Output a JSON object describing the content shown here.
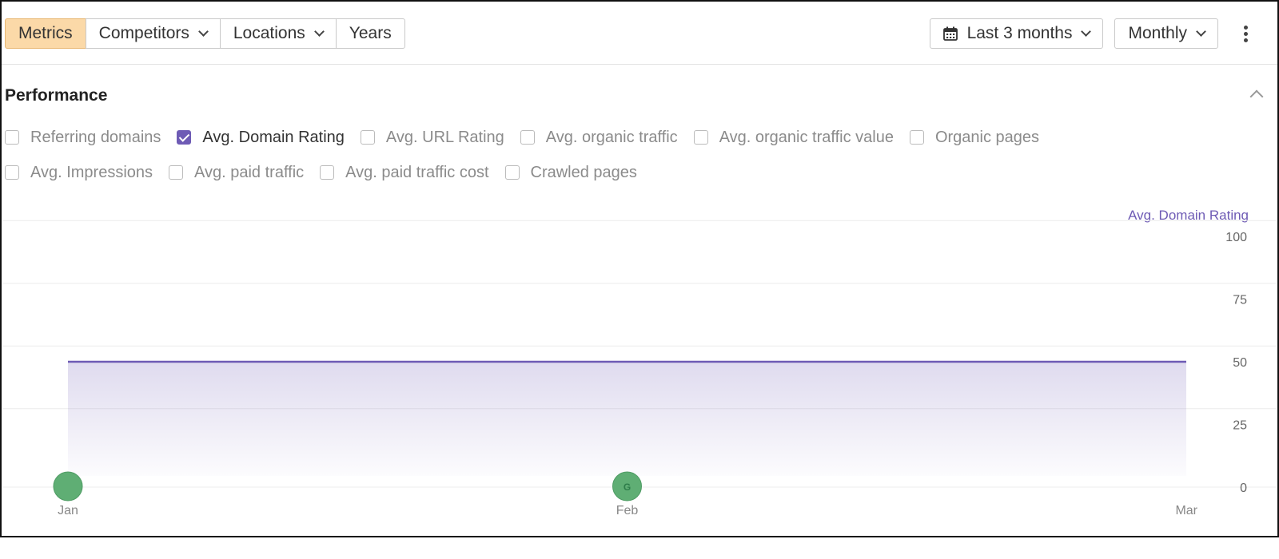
{
  "toolbar": {
    "tabs": [
      {
        "label": "Metrics",
        "active": true,
        "dropdown": false
      },
      {
        "label": "Competitors",
        "active": false,
        "dropdown": true
      },
      {
        "label": "Locations",
        "active": false,
        "dropdown": true
      },
      {
        "label": "Years",
        "active": false,
        "dropdown": false
      }
    ],
    "date_range": "Last 3 months",
    "granularity": "Monthly",
    "more_icon": "kebab-icon"
  },
  "performance": {
    "title": "Performance",
    "checkboxes_row1": [
      {
        "label": "Referring domains",
        "checked": false
      },
      {
        "label": "Avg. Domain Rating",
        "checked": true
      },
      {
        "label": "Avg. URL Rating",
        "checked": false
      },
      {
        "label": "Avg. organic traffic",
        "checked": false
      },
      {
        "label": "Avg. organic traffic value",
        "checked": false
      },
      {
        "label": "Organic pages",
        "checked": false
      }
    ],
    "checkboxes_row2": [
      {
        "label": "Avg. Impressions",
        "checked": false
      },
      {
        "label": "Avg. paid traffic",
        "checked": false
      },
      {
        "label": "Avg. paid traffic cost",
        "checked": false
      },
      {
        "label": "Crawled pages",
        "checked": false
      }
    ]
  },
  "colors": {
    "accent": "#6e5bb5",
    "active_tab": "#fbd9a8",
    "annotation": "#5fae74"
  },
  "chart_data": {
    "type": "area",
    "series": [
      {
        "name": "Avg. Domain Rating",
        "x": [
          "Jan",
          "Mar"
        ],
        "values": [
          50,
          50
        ]
      }
    ],
    "x_ticks": [
      "Jan",
      "Feb",
      "Mar"
    ],
    "y_ticks": [
      0,
      25,
      50,
      75,
      100
    ],
    "ylim": [
      0,
      100
    ],
    "y_axis_label": "Avg. Domain Rating",
    "grid": true,
    "annotations": [
      {
        "x": "Jan",
        "label": ""
      },
      {
        "x": "Feb",
        "label": "G"
      }
    ]
  }
}
